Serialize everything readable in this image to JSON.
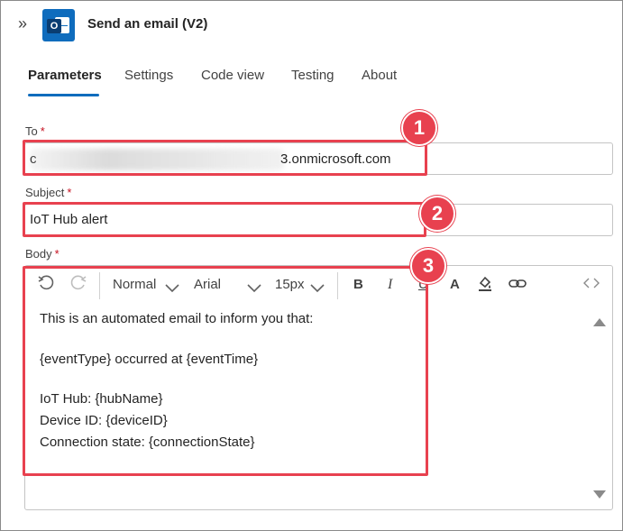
{
  "header": {
    "expand_icon": "chevron-double-right-icon",
    "app_icon": "outlook-icon",
    "title": "Send an email (V2)"
  },
  "tabs": [
    {
      "label": "Parameters",
      "active": true
    },
    {
      "label": "Settings",
      "active": false
    },
    {
      "label": "Code view",
      "active": false
    },
    {
      "label": "Testing",
      "active": false
    },
    {
      "label": "About",
      "active": false
    }
  ],
  "to": {
    "label": "To",
    "required_mark": "*",
    "value_visible": "3.onmicrosoft.com",
    "value_prefix_visible": "c"
  },
  "subject": {
    "label": "Subject",
    "required_mark": "*",
    "value": "IoT Hub alert"
  },
  "body": {
    "label": "Body",
    "required_mark": "*",
    "toolbar": {
      "style": "Normal",
      "font": "Arial",
      "size": "15px",
      "bold": "B",
      "italic": "I",
      "underline": "U",
      "font_color": "A"
    },
    "lines": [
      "This is an automated email to inform you that:",
      "{eventType} occurred at {eventTime}",
      "IoT Hub: {hubName}",
      "Device ID: {deviceID}",
      "Connection state: {connectionState}"
    ]
  },
  "callouts": [
    "1",
    "2",
    "3"
  ],
  "colors": {
    "accent": "#0f6cbd",
    "callout": "#e8414f",
    "required": "#c50f1f"
  }
}
